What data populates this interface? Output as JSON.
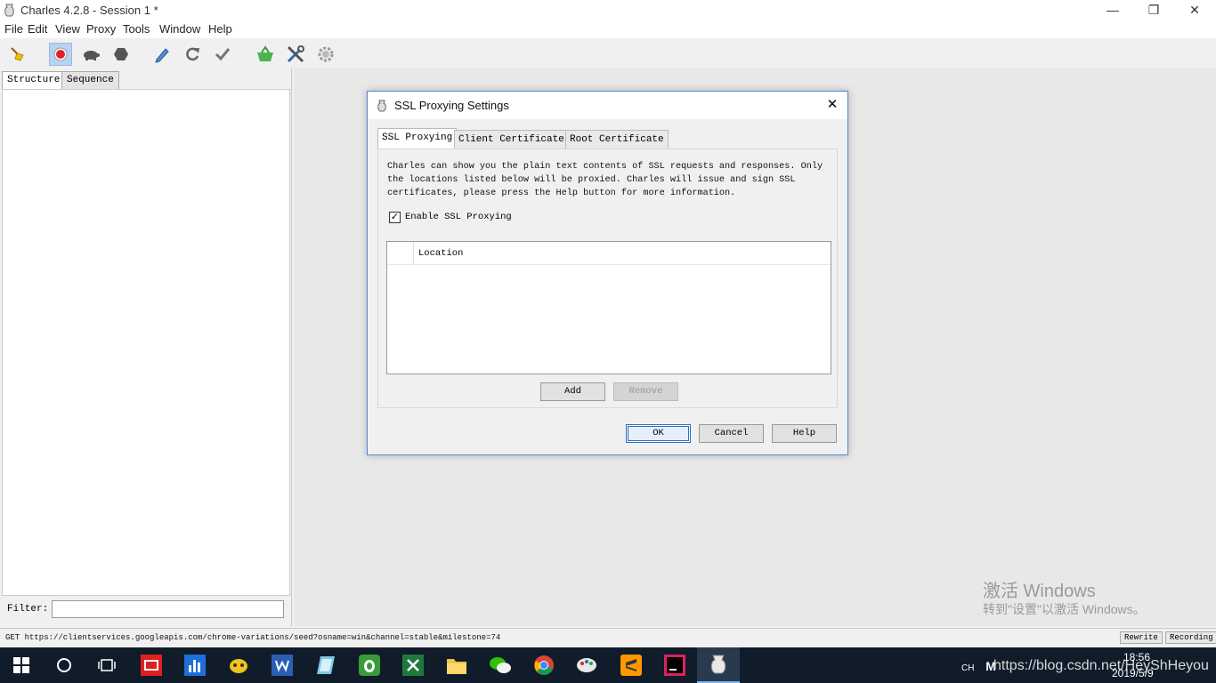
{
  "window": {
    "title": "Charles 4.2.8 - Session 1 *",
    "minimize_glyph": "—",
    "restore_glyph": "❐",
    "close_glyph": "✕"
  },
  "menu": [
    "File",
    "Edit",
    "View",
    "Proxy",
    "Tools",
    "Window",
    "Help"
  ],
  "toolbar": {
    "icons": [
      "broom-icon",
      "record-icon",
      "throttle-turtle-icon",
      "breakpoints-hexagon-icon",
      "compose-pen-icon",
      "repeat-icon",
      "validate-check-icon",
      "basket-icon",
      "tools-icon",
      "settings-gear-icon"
    ],
    "active": "record-icon",
    "accent_color": "#e0202a"
  },
  "left_panel": {
    "tabs": [
      "Structure",
      "Sequence"
    ],
    "selected_tab": "Structure",
    "filter_label": "Filter:",
    "filter_value": ""
  },
  "dialog": {
    "title": "SSL Proxying Settings",
    "close_glyph": "✕",
    "tabs": [
      "SSL Proxying",
      "Client Certificates",
      "Root Certificate"
    ],
    "selected_tab": "SSL Proxying",
    "description": "Charles can show you the plain text contents of SSL requests and responses. Only the locations listed below will be proxied. Charles will issue and sign SSL certificates, please press the Help button for more information.",
    "enable_label": "Enable SSL Proxying",
    "enable_checked": true,
    "enable_check_glyph": "✓",
    "table_header": "Location",
    "locations": [],
    "add_label": "Add",
    "remove_label": "Remove",
    "ok_label": "OK",
    "cancel_label": "Cancel",
    "help_label": "Help"
  },
  "watermark": {
    "line1": "激活 Windows",
    "line2": "转到\"设置\"以激活 Windows。"
  },
  "status_bar": {
    "text": "GET https://clientservices.googleapis.com/chrome-variations/seed?osname=win&channel=stable&milestone=74",
    "rewrite_label": "Rewrite",
    "recording_label": "Recording"
  },
  "taskbar": {
    "apps": [
      "windows-start-icon",
      "search-circle-icon",
      "task-view-icon",
      "youdao-icon",
      "chart-app-icon",
      "bee-app-icon",
      "word-icon",
      "notepad-icon",
      "evernote-icon",
      "excel-icon",
      "file-explorer-icon",
      "wechat-icon",
      "chrome-icon",
      "paint-icon",
      "sublime-icon",
      "intellij-icon",
      "charles-icon"
    ],
    "tray_lang": "CH",
    "tray_ime": "M",
    "csdn_url": "https://blog.csdn.net/HeyShHeyou",
    "time": "18:56",
    "date": "2019/5/9"
  }
}
